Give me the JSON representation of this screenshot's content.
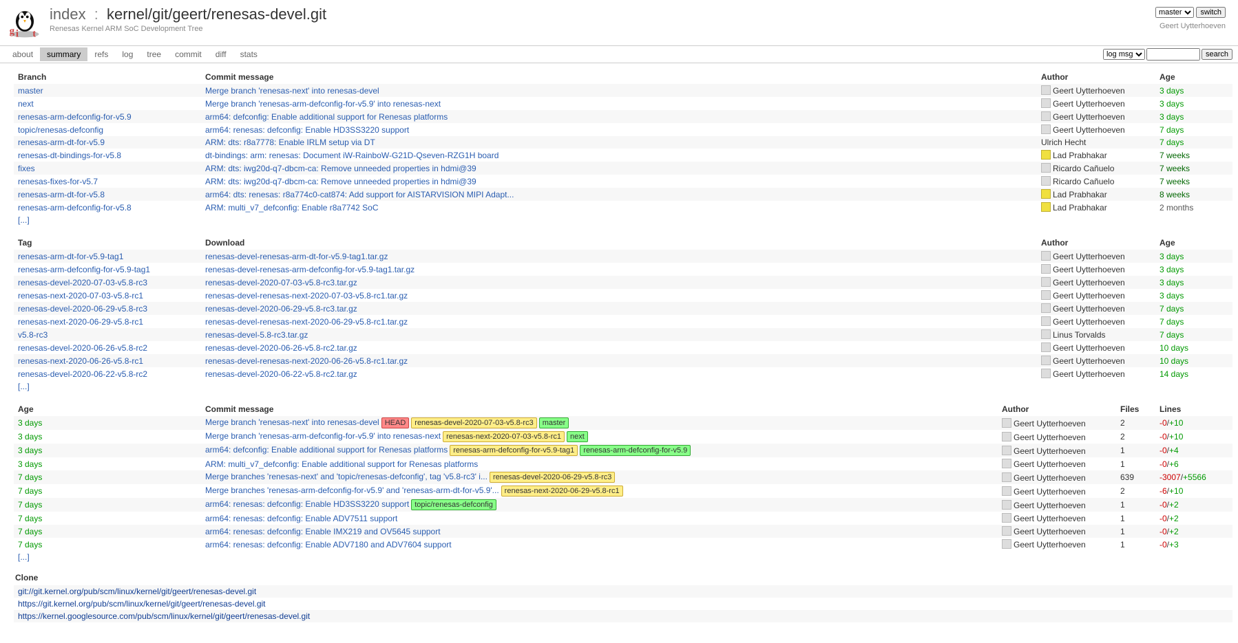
{
  "header": {
    "index_label": "index",
    "repo_name": "kernel/git/geert/renesas-devel.git",
    "description": "Renesas Kernel ARM SoC Development Tree",
    "branch_selected": "master",
    "switch_label": "switch",
    "owner": "Geert Uytterhoeven"
  },
  "tabs": {
    "about": "about",
    "summary": "summary",
    "refs": "refs",
    "log": "log",
    "tree": "tree",
    "commit": "commit",
    "diff": "diff",
    "stats": "stats"
  },
  "search": {
    "type_selected": "log msg",
    "search_label": "search"
  },
  "branch_table": {
    "headers": {
      "branch": "Branch",
      "msg": "Commit message",
      "author": "Author",
      "age": "Age"
    },
    "rows": [
      {
        "branch": "master",
        "msg": "Merge branch 'renesas-next' into renesas-devel",
        "author": "Geert Uytterhoeven",
        "age": "3 days",
        "grav": "plain"
      },
      {
        "branch": "next",
        "msg": "Merge branch 'renesas-arm-defconfig-for-v5.9' into renesas-next",
        "author": "Geert Uytterhoeven",
        "age": "3 days",
        "grav": "plain"
      },
      {
        "branch": "renesas-arm-defconfig-for-v5.9",
        "msg": "arm64: defconfig: Enable additional support for Renesas platforms",
        "author": "Geert Uytterhoeven",
        "age": "3 days",
        "grav": "plain"
      },
      {
        "branch": "topic/renesas-defconfig",
        "msg": "arm64: renesas: defconfig: Enable HD3SS3220 support",
        "author": "Geert Uytterhoeven",
        "age": "7 days",
        "grav": "plain"
      },
      {
        "branch": "renesas-arm-dt-for-v5.9",
        "msg": "ARM: dts: r8a7778: Enable IRLM setup via DT",
        "author": "Ulrich Hecht",
        "age": "7 days",
        "grav": "none"
      },
      {
        "branch": "renesas-dt-bindings-for-v5.8",
        "msg": "dt-bindings: arm: renesas: Document iW-RainboW-G21D-Qseven-RZG1H board",
        "author": "Lad Prabhakar",
        "age": "7 weeks",
        "grav": "yellow"
      },
      {
        "branch": "fixes",
        "msg": "ARM: dts: iwg20d-q7-dbcm-ca: Remove unneeded properties in hdmi@39",
        "author": "Ricardo Cañuelo",
        "age": "7 weeks",
        "grav": "plain"
      },
      {
        "branch": "renesas-fixes-for-v5.7",
        "msg": "ARM: dts: iwg20d-q7-dbcm-ca: Remove unneeded properties in hdmi@39",
        "author": "Ricardo Cañuelo",
        "age": "7 weeks",
        "grav": "plain"
      },
      {
        "branch": "renesas-arm-dt-for-v5.8",
        "msg": "arm64: dts: renesas: r8a774c0-cat874: Add support for AISTARVISION MIPI Adapt...",
        "author": "Lad Prabhakar",
        "age": "8 weeks",
        "grav": "yellow"
      },
      {
        "branch": "renesas-arm-defconfig-for-v5.8",
        "msg": "ARM: multi_v7_defconfig: Enable r8a7742 SoC",
        "author": "Lad Prabhakar",
        "age": "2 months",
        "grav": "yellow"
      }
    ],
    "more": "[...]"
  },
  "tag_table": {
    "headers": {
      "tag": "Tag",
      "download": "Download",
      "author": "Author",
      "age": "Age"
    },
    "rows": [
      {
        "tag": "renesas-arm-dt-for-v5.9-tag1",
        "dl": "renesas-devel-renesas-arm-dt-for-v5.9-tag1.tar.gz",
        "author": "Geert Uytterhoeven",
        "age": "3 days"
      },
      {
        "tag": "renesas-arm-defconfig-for-v5.9-tag1",
        "dl": "renesas-devel-renesas-arm-defconfig-for-v5.9-tag1.tar.gz",
        "author": "Geert Uytterhoeven",
        "age": "3 days"
      },
      {
        "tag": "renesas-devel-2020-07-03-v5.8-rc3",
        "dl": "renesas-devel-2020-07-03-v5.8-rc3.tar.gz",
        "author": "Geert Uytterhoeven",
        "age": "3 days"
      },
      {
        "tag": "renesas-next-2020-07-03-v5.8-rc1",
        "dl": "renesas-devel-renesas-next-2020-07-03-v5.8-rc1.tar.gz",
        "author": "Geert Uytterhoeven",
        "age": "3 days"
      },
      {
        "tag": "renesas-devel-2020-06-29-v5.8-rc3",
        "dl": "renesas-devel-2020-06-29-v5.8-rc3.tar.gz",
        "author": "Geert Uytterhoeven",
        "age": "7 days"
      },
      {
        "tag": "renesas-next-2020-06-29-v5.8-rc1",
        "dl": "renesas-devel-renesas-next-2020-06-29-v5.8-rc1.tar.gz",
        "author": "Geert Uytterhoeven",
        "age": "7 days"
      },
      {
        "tag": "v5.8-rc3",
        "dl": "renesas-devel-5.8-rc3.tar.gz",
        "author": "Linus Torvalds",
        "age": "7 days"
      },
      {
        "tag": "renesas-devel-2020-06-26-v5.8-rc2",
        "dl": "renesas-devel-2020-06-26-v5.8-rc2.tar.gz",
        "author": "Geert Uytterhoeven",
        "age": "10 days"
      },
      {
        "tag": "renesas-next-2020-06-26-v5.8-rc1",
        "dl": "renesas-devel-renesas-next-2020-06-26-v5.8-rc1.tar.gz",
        "author": "Geert Uytterhoeven",
        "age": "10 days"
      },
      {
        "tag": "renesas-devel-2020-06-22-v5.8-rc2",
        "dl": "renesas-devel-2020-06-22-v5.8-rc2.tar.gz",
        "author": "Geert Uytterhoeven",
        "age": "14 days"
      }
    ],
    "more": "[...]"
  },
  "log_table": {
    "headers": {
      "age": "Age",
      "msg": "Commit message",
      "author": "Author",
      "files": "Files",
      "lines": "Lines"
    },
    "rows": [
      {
        "age": "3 days",
        "msg": "Merge branch 'renesas-next' into renesas-devel",
        "decors": [
          [
            "HEAD",
            "head"
          ],
          [
            "renesas-devel-2020-07-03-v5.8-rc3",
            "tag"
          ],
          [
            "master",
            "branch"
          ]
        ],
        "author": "Geert Uytterhoeven",
        "files": "2",
        "del": "-0",
        "add": "+10"
      },
      {
        "age": "3 days",
        "msg": "Merge branch 'renesas-arm-defconfig-for-v5.9' into renesas-next",
        "decors": [
          [
            "renesas-next-2020-07-03-v5.8-rc1",
            "tag"
          ],
          [
            "next",
            "branch"
          ]
        ],
        "author": "Geert Uytterhoeven",
        "files": "2",
        "del": "-0",
        "add": "+10"
      },
      {
        "age": "3 days",
        "msg": "arm64: defconfig: Enable additional support for Renesas platforms",
        "decors": [
          [
            "renesas-arm-defconfig-for-v5.9-tag1",
            "tag"
          ],
          [
            "renesas-arm-defconfig-for-v5.9",
            "branch"
          ]
        ],
        "author": "Geert Uytterhoeven",
        "files": "1",
        "del": "-0",
        "add": "+4"
      },
      {
        "age": "3 days",
        "msg": "ARM: multi_v7_defconfig: Enable additional support for Renesas platforms",
        "decors": [],
        "author": "Geert Uytterhoeven",
        "files": "1",
        "del": "-0",
        "add": "+6"
      },
      {
        "age": "7 days",
        "msg": "Merge branches 'renesas-next' and 'topic/renesas-defconfig', tag 'v5.8-rc3' i...",
        "decors": [
          [
            "renesas-devel-2020-06-29-v5.8-rc3",
            "tag"
          ]
        ],
        "author": "Geert Uytterhoeven",
        "files": "639",
        "del": "-3007",
        "add": "+5566"
      },
      {
        "age": "7 days",
        "msg": "Merge branches 'renesas-arm-defconfig-for-v5.9' and 'renesas-arm-dt-for-v5.9'...",
        "decors": [
          [
            "renesas-next-2020-06-29-v5.8-rc1",
            "tag"
          ]
        ],
        "author": "Geert Uytterhoeven",
        "files": "2",
        "del": "-6",
        "add": "+10"
      },
      {
        "age": "7 days",
        "msg": "arm64: renesas: defconfig: Enable HD3SS3220 support",
        "decors": [
          [
            "topic/renesas-defconfig",
            "branch"
          ]
        ],
        "author": "Geert Uytterhoeven",
        "files": "1",
        "del": "-0",
        "add": "+2"
      },
      {
        "age": "7 days",
        "msg": "arm64: renesas: defconfig: Enable ADV7511 support",
        "decors": [],
        "author": "Geert Uytterhoeven",
        "files": "1",
        "del": "-0",
        "add": "+2"
      },
      {
        "age": "7 days",
        "msg": "arm64: renesas: defconfig: Enable IMX219 and OV5645 support",
        "decors": [],
        "author": "Geert Uytterhoeven",
        "files": "1",
        "del": "-0",
        "add": "+2"
      },
      {
        "age": "7 days",
        "msg": "arm64: renesas: defconfig: Enable ADV7180 and ADV7604 support",
        "decors": [],
        "author": "Geert Uytterhoeven",
        "files": "1",
        "del": "-0",
        "add": "+3"
      }
    ],
    "more": "[...]"
  },
  "clone": {
    "header": "Clone",
    "urls": [
      "git://git.kernel.org/pub/scm/linux/kernel/git/geert/renesas-devel.git",
      "https://git.kernel.org/pub/scm/linux/kernel/git/geert/renesas-devel.git",
      "https://kernel.googlesource.com/pub/scm/linux/kernel/git/geert/renesas-devel.git"
    ]
  }
}
